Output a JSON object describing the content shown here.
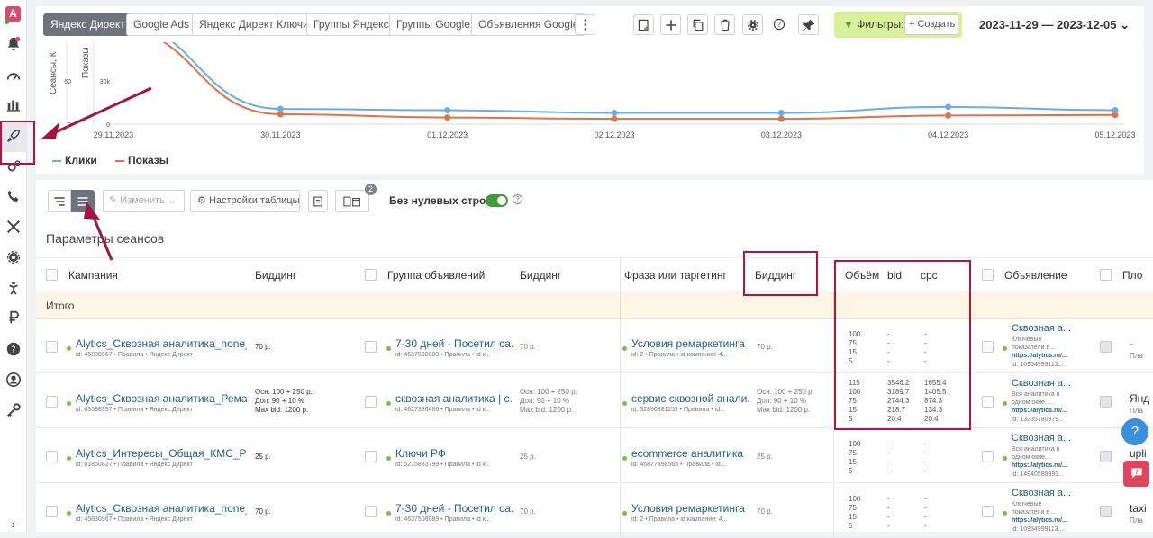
{
  "app": {
    "logo_letter": "A"
  },
  "tabs": [
    "Яндекс Директ",
    "Google Ads",
    "Яндекс Директ Ключи",
    "Группы Яндекс",
    "Группы Google",
    "Объявления Google"
  ],
  "toolbar": {
    "more": "⋮",
    "filters_label": "Фильтры:",
    "create_label": "+ Создать",
    "date_range": "2023-11-29 — 2023-12-05",
    "date_caret": "⌄"
  },
  "chart_data": {
    "type": "line",
    "x": [
      "29.11.2023",
      "30.11.2023",
      "01.12.2023",
      "02.12.2023",
      "03.12.2023",
      "04.12.2023",
      "05.12.2023"
    ],
    "series": [
      {
        "name": "Клики",
        "color": "#6aaee0",
        "values": [
          155,
          23,
          21,
          17,
          17,
          26,
          21
        ]
      },
      {
        "name": "Показы",
        "color": "#e0714d",
        "values": [
          145,
          15,
          10,
          8,
          8,
          13,
          14
        ]
      }
    ],
    "y_left_ticks": [
      "60",
      "0"
    ],
    "y_right_ticks": [
      "30k",
      "0"
    ],
    "ylabel_left": "Сеансы, К",
    "ylabel_right": "Показы",
    "ylim": [
      0,
      140
    ],
    "legend": "bottom-left"
  },
  "table_toolbar": {
    "edit_label": "Изменить",
    "settings_label": "Настройки таблицы",
    "badge": "2",
    "zero_rows_label": "Без нулевых строк",
    "help": "?"
  },
  "section_title": "Параметры сеансов",
  "columns": {
    "campaign": "Кампания",
    "bidding1": "Биддинг",
    "group": "Группа объявлений",
    "bidding2": "Биддинг",
    "phrase": "Фраза или таргетинг",
    "bidding3": "Биддинг",
    "volume": "Объём",
    "bid": "bid",
    "cpc": "cpc",
    "ad": "Объявление",
    "placement": "Пло"
  },
  "total_label": "Итого",
  "rows": [
    {
      "campaign": "Alytics_Сквозная аналитика_none_...",
      "campaign_meta": "id: 45830967 • Правила • Яндекс Директ",
      "bid1": [
        "70 р."
      ],
      "group": "7-30 дней - Посетил са...",
      "group_meta": "id: 4637508089 • Правила • id к...",
      "bid2": [
        "70 р."
      ],
      "phrase": "Условия ремаркетинга",
      "phrase_meta": "id: 2 • Правила • id кампании: 4...",
      "bid3": [
        "70 р."
      ],
      "volume": [
        "100",
        "75",
        "15",
        "5"
      ],
      "bids": [
        "-",
        "-",
        "-",
        "-"
      ],
      "cpcs": [
        "-",
        "-",
        "-",
        "-"
      ],
      "ad_title": "Сквозная а...",
      "ad_desc": [
        "Ключевые",
        "показатели в ..."
      ],
      "ad_url": "https://alytics.ru/...",
      "ad_id": "id: 10954999112...",
      "place": "-",
      "place_sub": "Пла"
    },
    {
      "campaign": "Alytics_Сквозная аналитика_Ремар...",
      "campaign_meta": "id: 63598397 • Правила • Яндекс Директ",
      "bid1": [
        "Осн: 100 + 250 р.",
        "Доп: 90 + 10 %",
        "Max bid: 1200 р."
      ],
      "group": "сквозная аналитика | с...",
      "group_meta": "id: 4627386486 • Правила • id к...",
      "bid2": [
        "Осн: 100 + 250 р.",
        "Доп: 90 + 10 %",
        "Max bid: 1200 р."
      ],
      "phrase": "сервис сквозной анали...",
      "phrase_meta": "id: 32890981153 • Правила • id...",
      "bid3": [
        "Осн: 100 + 250 р.",
        "Доп: 90 + 10 %",
        "Max bid: 1200 р."
      ],
      "volume": [
        "115",
        "100",
        "75",
        "15",
        "5"
      ],
      "bids": [
        "3546.2",
        "3189.7",
        "2744.3",
        "218.7",
        "20.4"
      ],
      "cpcs": [
        "1655.4",
        "1405.5",
        "874.3",
        "134.3",
        "20.4"
      ],
      "ad_title": "Сквозная а...",
      "ad_desc": [
        "Вся аналитика в",
        "одном окне...."
      ],
      "ad_url": "https://alytics.ru/...",
      "ad_id": "id: 13235780979...",
      "place": "Янд",
      "place_sub": "Пла"
    },
    {
      "campaign": "Alytics_Интересы_Общая_КМС_РФ",
      "campaign_meta": "id: 81850827 • Правила • Яндекс Директ",
      "bid1": [
        "25 р."
      ],
      "group": "Ключи РФ",
      "group_meta": "id: 5275833799 • Правила • id к...",
      "bid2": [
        "25 р."
      ],
      "phrase": "ecommerce аналитика",
      "phrase_meta": "id: 46877498565 • Правила • id...",
      "bid3": [
        "25 р."
      ],
      "volume": [
        "100",
        "75",
        "15",
        "5"
      ],
      "bids": [
        "-",
        "-",
        "-",
        "-"
      ],
      "cpcs": [
        "-",
        "-",
        "-",
        "-"
      ],
      "ad_title": "Сквозная а...",
      "ad_desc": [
        "Вся аналитика в",
        "одном окне...."
      ],
      "ad_url": "https://alytics.ru/...",
      "ad_id": "id: 14940588993...",
      "place": "upli",
      "place_sub": "Пла"
    },
    {
      "campaign": "Alytics_Сквозная аналитика_none_...",
      "campaign_meta": "id: 45830967 • Правила • Яндекс Директ",
      "bid1": [
        "70 р."
      ],
      "group": "7-30 дней - Посетил са...",
      "group_meta": "id: 4637508089 • Правила • id к...",
      "bid2": [
        "70 р."
      ],
      "phrase": "Условия ремаркетинга",
      "phrase_meta": "id: 2 • Правила • id кампании: 4...",
      "bid3": [
        "70 р."
      ],
      "volume": [
        "100",
        "75",
        "15",
        "5"
      ],
      "bids": [
        "-",
        "-",
        "-",
        "-"
      ],
      "cpcs": [
        "-",
        "-",
        "-",
        "-"
      ],
      "ad_title": "Сквозная а...",
      "ad_desc": [
        "Ключевые",
        "показатели в ..."
      ],
      "ad_url": "https://alytics.ru/...",
      "ad_id": "id: 10954999113...",
      "place": "taxi",
      "place_sub": "Пла"
    }
  ],
  "colors": {
    "accent_red": "#b0163e",
    "link": "#1f5d8f",
    "filters_bg": "#d8f19a",
    "total_bg": "#fdf5e6",
    "status_green": "#7bc043"
  }
}
